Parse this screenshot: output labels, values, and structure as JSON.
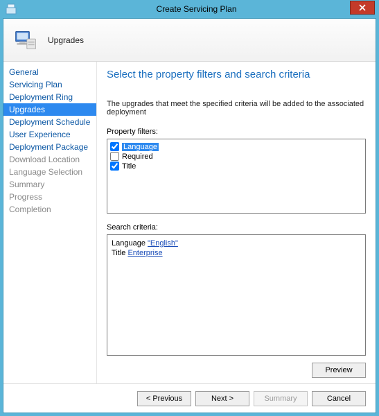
{
  "window": {
    "title": "Create Servicing Plan"
  },
  "header": {
    "page_name": "Upgrades"
  },
  "sidebar": {
    "items": [
      {
        "label": "General",
        "state": "enabled"
      },
      {
        "label": "Servicing Plan",
        "state": "enabled"
      },
      {
        "label": "Deployment Ring",
        "state": "enabled"
      },
      {
        "label": "Upgrades",
        "state": "selected"
      },
      {
        "label": "Deployment Schedule",
        "state": "enabled"
      },
      {
        "label": "User Experience",
        "state": "enabled"
      },
      {
        "label": "Deployment Package",
        "state": "enabled"
      },
      {
        "label": "Download Location",
        "state": "disabled"
      },
      {
        "label": "Language Selection",
        "state": "disabled"
      },
      {
        "label": "Summary",
        "state": "disabled"
      },
      {
        "label": "Progress",
        "state": "disabled"
      },
      {
        "label": "Completion",
        "state": "disabled"
      }
    ]
  },
  "main": {
    "title": "Select the property filters and search criteria",
    "intro": "The upgrades that meet the specified criteria will be added to the associated deployment",
    "property_filters_label": "Property filters:",
    "filters": [
      {
        "label": "Language",
        "checked": true,
        "selected": true
      },
      {
        "label": "Required",
        "checked": false,
        "selected": false
      },
      {
        "label": "Title",
        "checked": true,
        "selected": false
      }
    ],
    "search_criteria_label": "Search criteria:",
    "criteria": [
      {
        "prefix": "Language ",
        "link": "\"English\""
      },
      {
        "prefix": "Title ",
        "link": "Enterprise"
      }
    ],
    "preview_label": "Preview"
  },
  "footer": {
    "previous": "< Previous",
    "next": "Next >",
    "summary": "Summary",
    "cancel": "Cancel"
  }
}
